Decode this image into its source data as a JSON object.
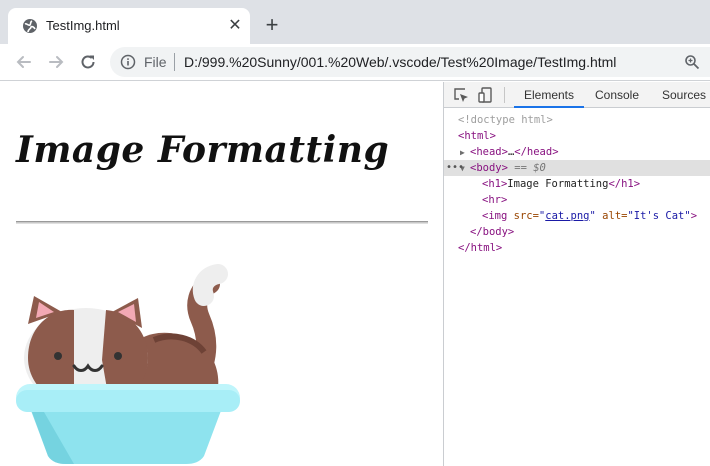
{
  "browser": {
    "tab": {
      "title": "TestImg.html",
      "close_glyph": "✕",
      "favicon": "globe-icon"
    },
    "new_tab_glyph": "+",
    "omnibox": {
      "scheme_label": "File",
      "url": "D:/999.%20Sunny/001.%20Web/.vscode/Test%20Image/TestImg.html"
    }
  },
  "page": {
    "heading": "Image Formatting",
    "image_alt": "It's Cat",
    "colors": {
      "cat_brown": "#8d5b4c",
      "litter_box": "#8ee3ee"
    }
  },
  "devtools": {
    "tabs": {
      "elements": "Elements",
      "console": "Console",
      "sources": "Sources"
    },
    "tree": {
      "doctype": "<!doctype html>",
      "html_open": "<html>",
      "head_open": "<head>",
      "head_ellipsis": "…",
      "head_close": "</head>",
      "body_open": "<body>",
      "body_marker": "== $0",
      "h1_open": "<h1>",
      "h1_text": "Image Formatting",
      "h1_close": "</h1>",
      "hr": "<hr>",
      "img_tag": "<img",
      "img_src_name": "src=",
      "img_src_value": "cat.png",
      "img_alt_name": "alt=",
      "img_alt_value": "\"It's Cat\"",
      "img_close": ">",
      "body_close": "</body>",
      "html_close": "</html>"
    }
  }
}
